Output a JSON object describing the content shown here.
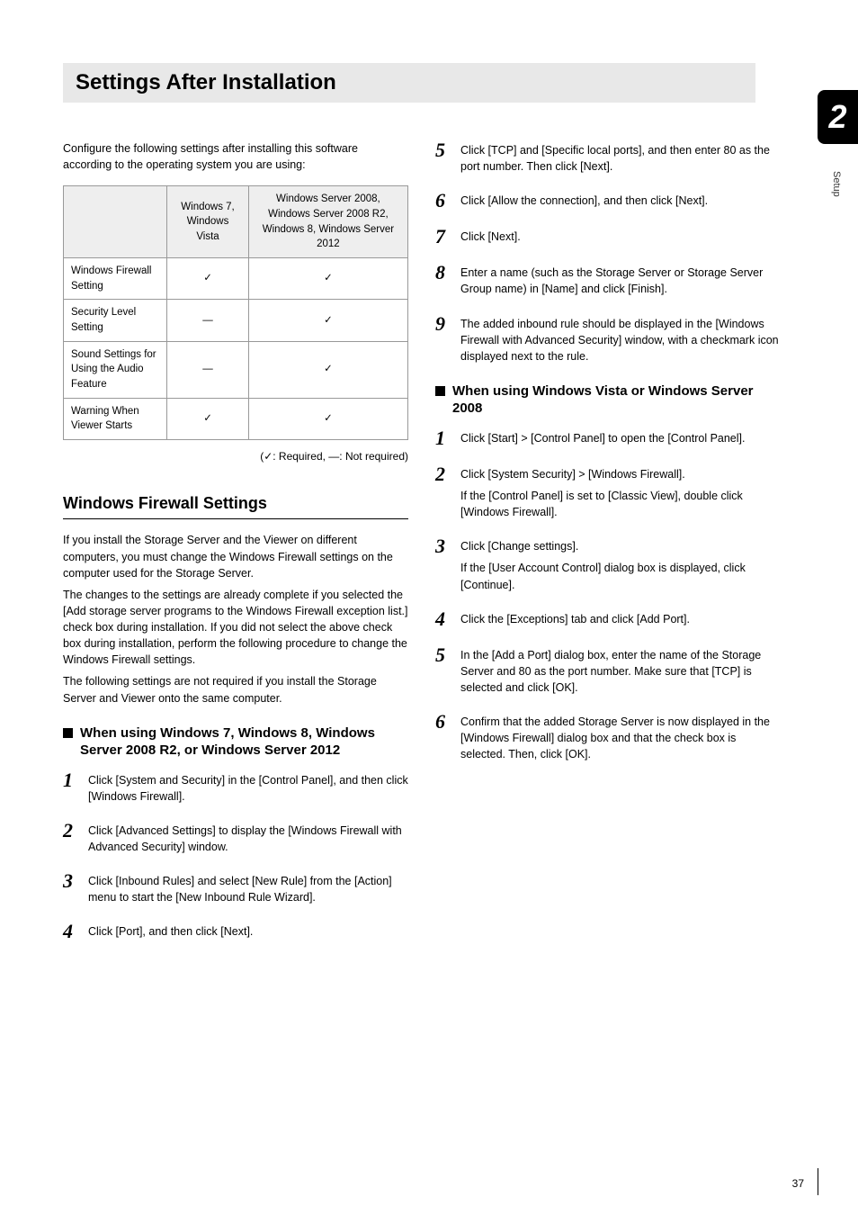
{
  "chapter_number": "2",
  "side_label": "Setup",
  "main_title": "Settings After Installation",
  "intro": "Configure the following settings after installing this software according to the operating system you are using:",
  "table": {
    "headers": [
      "",
      "Windows 7, Windows Vista",
      "Windows Server 2008, Windows Server 2008 R2, Windows 8, Windows Server 2012"
    ],
    "rows": [
      {
        "label": "Windows Firewall Setting",
        "c1": "✓",
        "c2": "✓"
      },
      {
        "label": "Security Level Setting",
        "c1": "—",
        "c2": "✓"
      },
      {
        "label": "Sound Settings for Using the Audio Feature",
        "c1": "—",
        "c2": "✓"
      },
      {
        "label": "Warning When Viewer Starts",
        "c1": "✓",
        "c2": "✓"
      }
    ]
  },
  "legend": "(✓: Required, —: Not required)",
  "section_heading": "Windows Firewall Settings",
  "firewall_paras": [
    "If you install the Storage Server and the Viewer on different computers, you must change the Windows Firewall settings on the computer used for the Storage Server.",
    "The changes to the settings are already complete if you selected the [Add storage server programs to the Windows Firewall exception list.] check box during installation. If you did not select the above check box during installation, perform the following procedure to change the Windows Firewall settings.",
    "The following settings are not required if you install the Storage Server and Viewer onto the same computer."
  ],
  "sub1_title": "When using Windows 7, Windows 8, Windows Server 2008 R2, or Windows Server 2012",
  "steps_a": [
    "Click [System and Security] in the [Control Panel], and then click [Windows Firewall].",
    "Click [Advanced Settings] to display the [Windows Firewall with Advanced Security] window.",
    "Click [Inbound Rules] and select [New Rule] from the [Action] menu to start the [New Inbound Rule Wizard].",
    "Click [Port], and then click [Next]."
  ],
  "steps_b": [
    "Click [TCP] and [Specific local ports], and then enter 80 as the port number. Then click [Next].",
    "Click [Allow the connection], and then click [Next].",
    "Click [Next].",
    "Enter a name (such as the Storage Server or Storage Server Group name) in [Name] and click [Finish].",
    "The added inbound rule should be displayed in the [Windows Firewall with Advanced Security] window, with a checkmark icon displayed next to the rule."
  ],
  "sub2_title": "When using Windows Vista or Windows Server 2008",
  "steps_c": [
    {
      "text": "Click [Start] > [Control Panel] to open the [Control Panel]."
    },
    {
      "text": "Click [System Security] > [Windows Firewall].",
      "note": "If the [Control Panel] is set to [Classic View], double click [Windows Firewall]."
    },
    {
      "text": "Click [Change settings].",
      "note": "If the [User Account Control] dialog box is displayed, click [Continue]."
    },
    {
      "text": "Click the [Exceptions] tab and click [Add Port]."
    },
    {
      "text": "In the [Add a Port] dialog box, enter the name of the Storage Server and 80 as the port number. Make sure that [TCP] is selected and click [OK]."
    },
    {
      "text": "Confirm that the added Storage Server is now displayed in the [Windows Firewall] dialog box and that the check box is selected. Then, click [OK]."
    }
  ],
  "page_number": "37"
}
